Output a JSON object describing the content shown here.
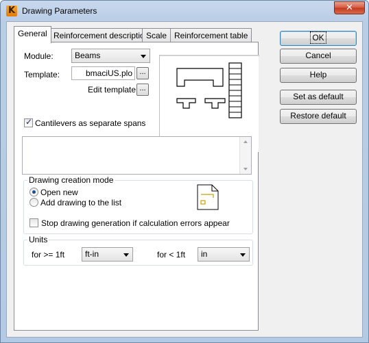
{
  "window": {
    "title": "Drawing Parameters",
    "close_glyph": "✕"
  },
  "tabs": [
    {
      "label": "General"
    },
    {
      "label": "Reinforcement description"
    },
    {
      "label": "Scale"
    },
    {
      "label": "Reinforcement table"
    }
  ],
  "general": {
    "module_label": "Module:",
    "module_value": "Beams",
    "template_label": "Template:",
    "template_value": "bmaciUS.plo",
    "template_browse": "...",
    "edit_template_label": "Edit template:",
    "edit_template_browse": "...",
    "cantilevers_label": "Cantilevers as separate spans",
    "cantilevers_checked": true
  },
  "creation_mode": {
    "legend": "Drawing creation mode",
    "open_new_label": "Open new",
    "add_drawing_label": "Add drawing to the list",
    "selected": "open_new",
    "stop_generation_label": "Stop drawing generation if calculation errors appear",
    "stop_generation_checked": false
  },
  "units": {
    "legend": "Units",
    "ge_label": "for >= 1ft",
    "ge_value": "ft-in",
    "lt_label": "for < 1ft",
    "lt_value": "in"
  },
  "buttons": {
    "ok": "OK",
    "cancel": "Cancel",
    "help": "Help",
    "set_default": "Set as default",
    "restore_default": "Restore default"
  },
  "icons": {
    "app": "app-logo-icon",
    "preview": "beam-drawing-preview-icon",
    "document": "drawing-document-icon"
  }
}
